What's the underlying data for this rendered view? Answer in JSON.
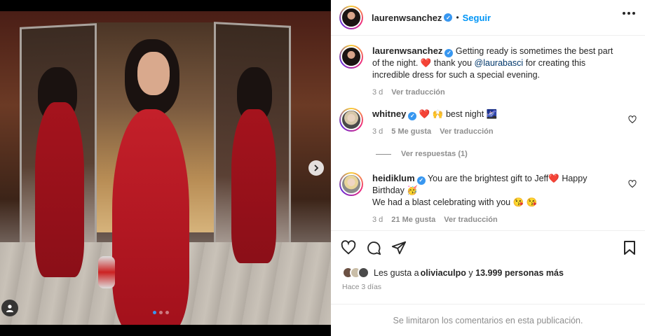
{
  "post": {
    "author": "laurenwsanchez",
    "separator": "•",
    "follow_label": "Seguir",
    "carousel_index": 1,
    "carousel_count": 3
  },
  "comments": [
    {
      "username": "laurenwsanchez",
      "text_1": "Getting ready is sometimes the best part of the night. ",
      "heart": "❤️",
      "text_2": " thank you ",
      "mention": "@laurabasci",
      "text_3": " for creating this incredible dress for such a special evening.",
      "time": "3 d",
      "translate": "Ver traducción"
    },
    {
      "username": "whitney",
      "text": "❤️ 🙌 best night 🌌",
      "time": "3 d",
      "likes": "5 Me gusta",
      "translate": "Ver traducción",
      "replies": "Ver respuestas (1)"
    },
    {
      "username": "heidiklum",
      "text": "You are the brightest gift to Jeff❤️  Happy Birthday 🥳",
      "text_2": "We had a blast celebrating with you 😘 😘",
      "time": "3 d",
      "likes": "21 Me gusta",
      "translate": "Ver traducción"
    }
  ],
  "likes": {
    "prefix": "Les gusta a ",
    "user": "oliviaculpo",
    "mid": " y ",
    "count": "13.999 personas más"
  },
  "posted_ago": "Hace 3 días",
  "footer_text": "Se limitaron los comentarios en esta publicación.",
  "colors": {
    "link": "#0095f6",
    "verified": "#3897f0",
    "dress": "#b3121f"
  }
}
